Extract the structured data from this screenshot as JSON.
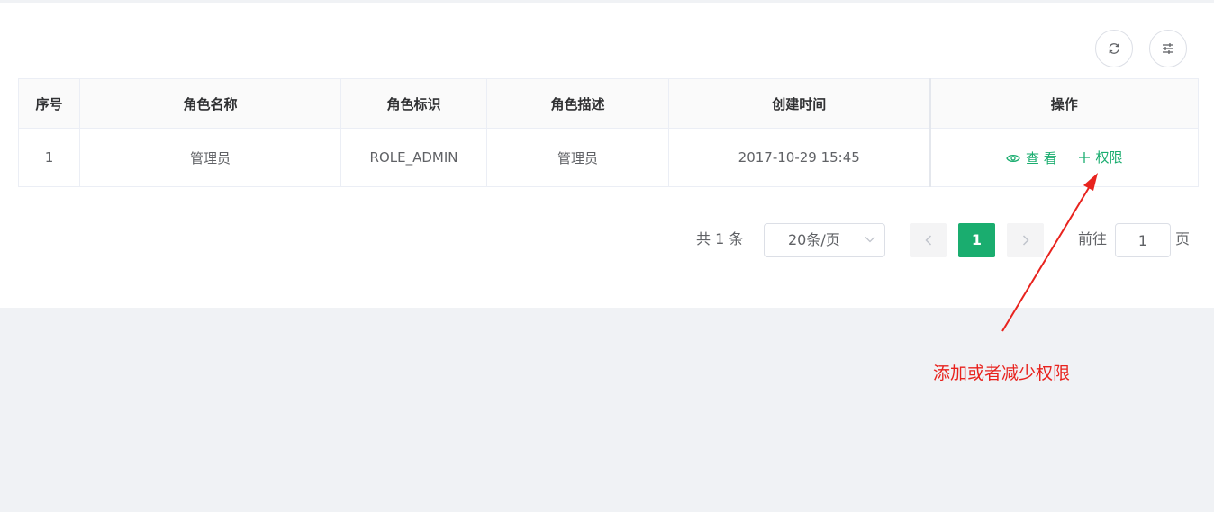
{
  "toolbar": {
    "refresh_icon": "refresh-icon",
    "filter_icon": "sliders-icon"
  },
  "table": {
    "headers": [
      "序号",
      "角色名称",
      "角色标识",
      "角色描述",
      "创建时间",
      "操作"
    ],
    "rows": [
      {
        "index": "1",
        "name": "管理员",
        "code": "ROLE_ADMIN",
        "description": "管理员",
        "created": "2017-10-29 15:45",
        "actions": {
          "view_label": "查 看",
          "view_icon": "eye-icon",
          "permission_label": "权限",
          "permission_icon": "plus-icon"
        }
      }
    ]
  },
  "pagination": {
    "total_text": "共 1 条",
    "page_size": "20条/页",
    "current_page": "1",
    "goto_label": "前往",
    "goto_value": "1",
    "page_suffix": "页"
  },
  "annotation": {
    "text": "添加或者减少权限",
    "color": "#e8231e"
  },
  "colors": {
    "accent": "#1aad6f",
    "background": "#f0f2f5"
  }
}
